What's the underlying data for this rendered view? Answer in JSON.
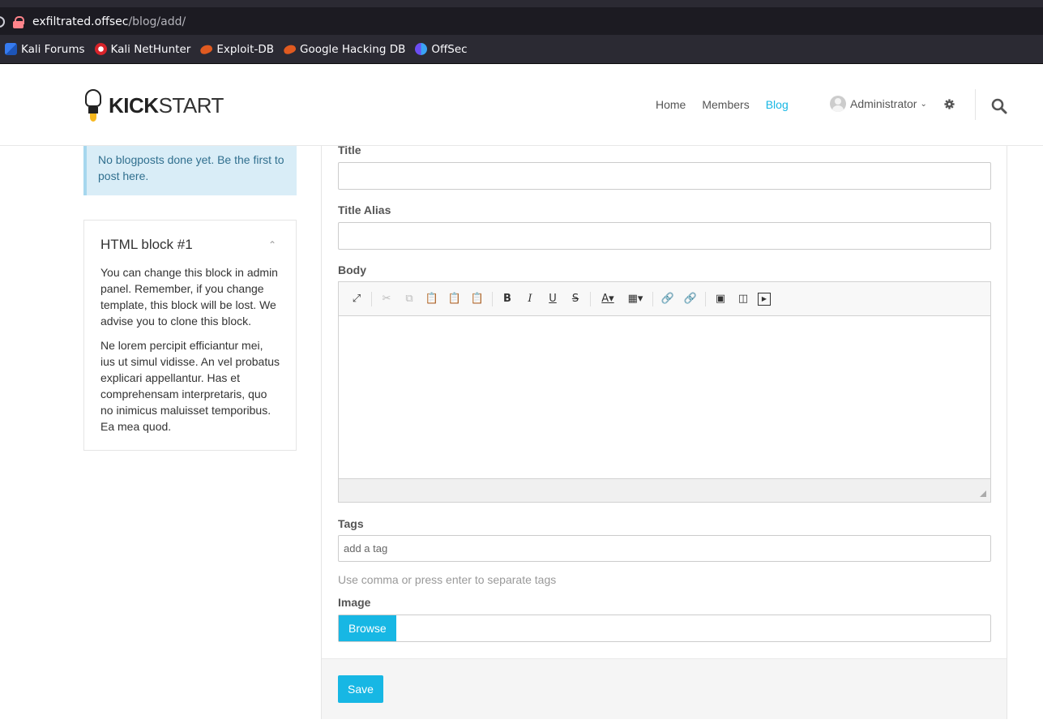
{
  "browser": {
    "url_host": "exfiltrated.offsec",
    "url_path": "/blog/add/",
    "bookmarks": [
      {
        "label": "Kali Forums"
      },
      {
        "label": "Kali NetHunter"
      },
      {
        "label": "Exploit-DB"
      },
      {
        "label": "Google Hacking DB"
      },
      {
        "label": "OffSec"
      }
    ]
  },
  "header": {
    "logo_bold": "KICK",
    "logo_light": "START",
    "nav": [
      {
        "label": "Home"
      },
      {
        "label": "Members"
      },
      {
        "label": "Blog"
      }
    ],
    "active_nav": "Blog",
    "user_name": "Administrator",
    "accent_color": "#17b7e4"
  },
  "sidebar": {
    "alert_text": "No blogposts done yet. Be the first to post here.",
    "block_title": "HTML block #1",
    "block_paragraphs": [
      "You can change this block in admin panel. Remember, if you change template, this block will be lost. We advise you to clone this block.",
      "Ne lorem percipit efficiantur mei, ius ut simul vidisse. An vel probatus explicari appellantur. Has et comprehensam interpretaris, quo no inimicus maluisset temporibus. Ea mea quod."
    ]
  },
  "form": {
    "title_label": "Title",
    "title_value": "",
    "alias_label": "Title Alias",
    "alias_value": "",
    "body_label": "Body",
    "tags_label": "Tags",
    "tags_placeholder": "add a tag",
    "tags_help": "Use comma or press enter to separate tags",
    "image_label": "Image",
    "browse_label": "Browse",
    "save_label": "Save"
  },
  "toolbar_icons": [
    "maximize-icon",
    "cut-icon",
    "copy-icon",
    "paste-icon",
    "paste-text-icon",
    "paste-word-icon",
    "bold-icon",
    "italic-icon",
    "underline-icon",
    "strike-icon",
    "text-color-icon",
    "bg-color-icon",
    "link-icon",
    "unlink-icon",
    "image-icon",
    "iframe-icon",
    "youtube-icon"
  ]
}
